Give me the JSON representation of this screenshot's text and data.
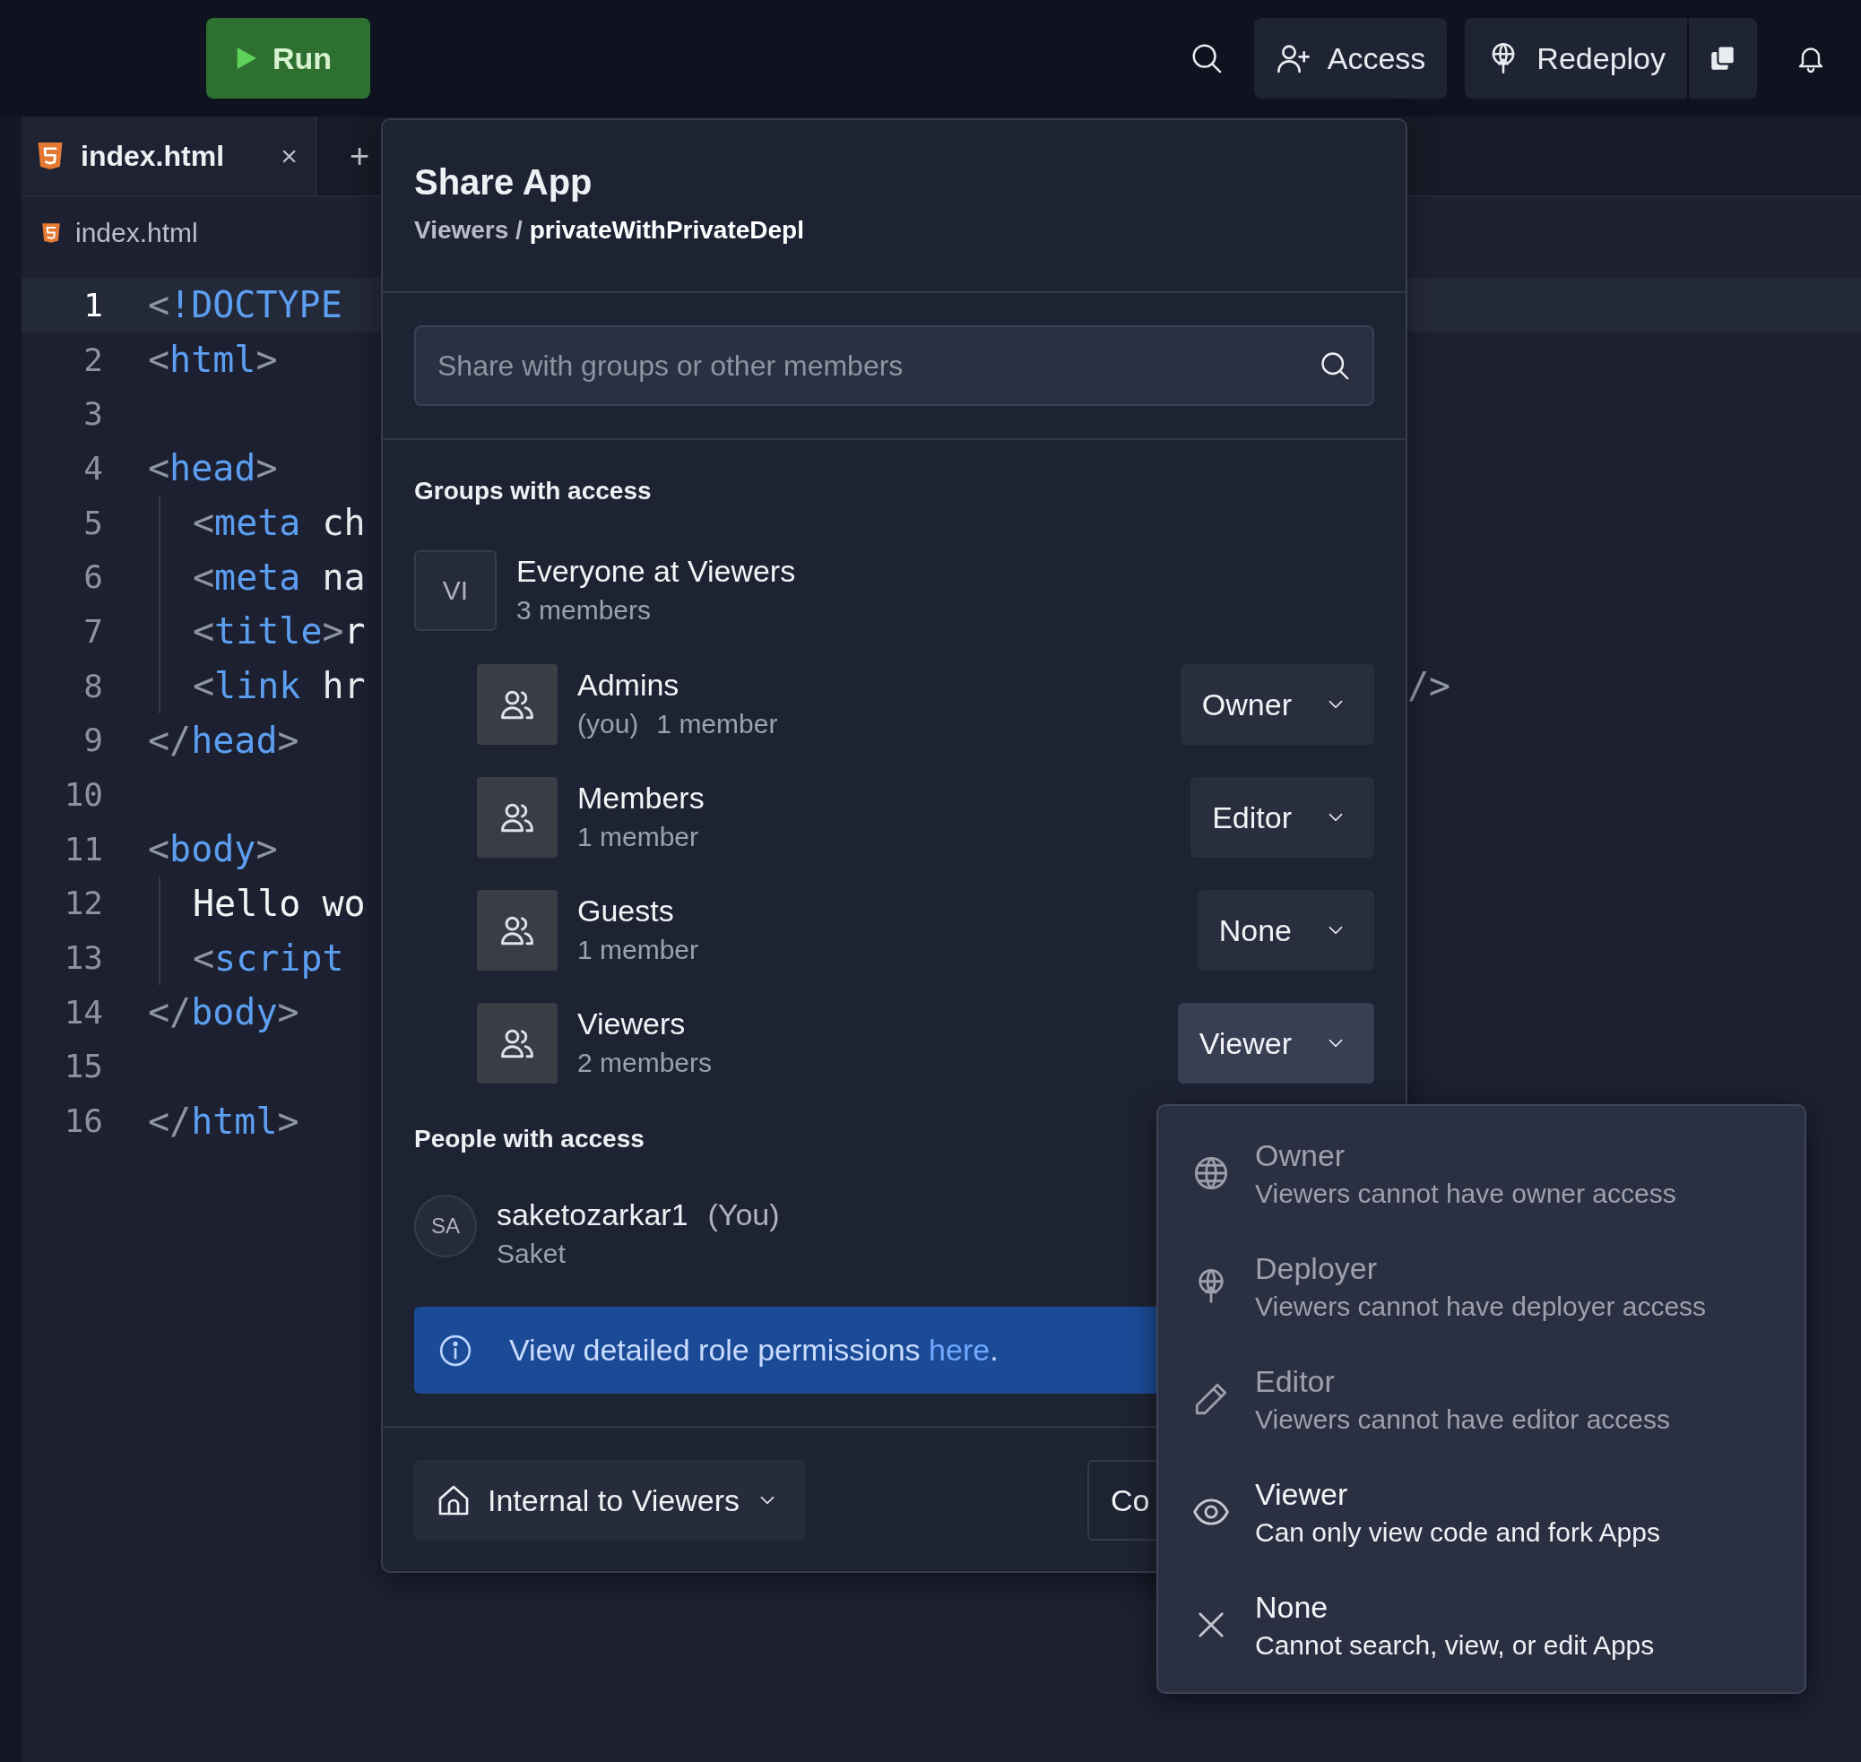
{
  "toolbar": {
    "run": "Run",
    "access": "Access",
    "redeploy": "Redeploy"
  },
  "editor": {
    "tabs": [
      {
        "label": "index.html",
        "close": "×",
        "selected": true
      }
    ],
    "new_tab": "+",
    "breadcrumb": "index.html",
    "lines": [
      {
        "number": "1",
        "current": true,
        "tokens": [
          {
            "kind": "punct",
            "text": "<"
          },
          {
            "kind": "tag",
            "text": "!DOCTYPE"
          }
        ]
      },
      {
        "number": "2",
        "current": false,
        "tokens": [
          {
            "kind": "punct",
            "text": "<"
          },
          {
            "kind": "tag",
            "text": "html"
          },
          {
            "kind": "punct",
            "text": ">"
          }
        ]
      },
      {
        "number": "3",
        "current": false
      },
      {
        "number": "4",
        "current": false,
        "tokens": [
          {
            "kind": "punct",
            "text": "<"
          },
          {
            "kind": "tag",
            "text": "head"
          },
          {
            "kind": "punct",
            "text": ">"
          }
        ],
        "children": [
          {
            "number": "5",
            "current": false,
            "tokens": [
              {
                "kind": "punct",
                "text": "<"
              },
              {
                "kind": "tag",
                "text": "meta"
              },
              {
                "kind": "attr",
                "text": " ch"
              }
            ]
          },
          {
            "number": "6",
            "current": false,
            "tokens": [
              {
                "kind": "punct",
                "text": "<"
              },
              {
                "kind": "tag",
                "text": "meta"
              },
              {
                "kind": "attr",
                "text": " na"
              }
            ]
          },
          {
            "number": "7",
            "current": false,
            "tokens": [
              {
                "kind": "punct",
                "text": "<"
              },
              {
                "kind": "tag",
                "text": "title"
              },
              {
                "kind": "punct",
                "text": ">"
              },
              {
                "kind": "text",
                "text": "r"
              }
            ]
          },
          {
            "number": "8",
            "current": false,
            "tokens": [
              {
                "kind": "punct",
                "text": "<"
              },
              {
                "kind": "tag",
                "text": "link"
              },
              {
                "kind": "attr",
                "text": " hr"
              }
            ],
            "tail": "/>"
          }
        ]
      },
      {
        "number": "9",
        "current": false,
        "tokens": [
          {
            "kind": "punct",
            "text": "</"
          },
          {
            "kind": "tag",
            "text": "head"
          },
          {
            "kind": "punct",
            "text": ">"
          }
        ]
      },
      {
        "number": "10",
        "current": false
      },
      {
        "number": "11",
        "current": false,
        "tokens": [
          {
            "kind": "punct",
            "text": "<"
          },
          {
            "kind": "tag",
            "text": "body"
          },
          {
            "kind": "punct",
            "text": ">"
          }
        ],
        "children": [
          {
            "number": "12",
            "current": false,
            "tokens": [
              {
                "kind": "text",
                "text": "Hello wo"
              }
            ]
          },
          {
            "number": "13",
            "current": false,
            "tokens": [
              {
                "kind": "punct",
                "text": "<"
              },
              {
                "kind": "tag",
                "text": "script"
              }
            ]
          }
        ]
      },
      {
        "number": "14",
        "current": false,
        "tokens": [
          {
            "kind": "punct",
            "text": "</"
          },
          {
            "kind": "tag",
            "text": "body"
          },
          {
            "kind": "punct",
            "text": ">"
          }
        ]
      },
      {
        "number": "15",
        "current": false
      },
      {
        "number": "16",
        "current": false,
        "tokens": [
          {
            "kind": "punct",
            "text": "</"
          },
          {
            "kind": "tag",
            "text": "html"
          },
          {
            "kind": "punct",
            "text": ">"
          }
        ]
      }
    ]
  },
  "share_dialog": {
    "title": "Share App",
    "org": "Viewers",
    "separator": "/",
    "app": "privateWithPrivateDepl",
    "search": {
      "placeholder": "Share with groups or other members"
    },
    "groups_heading": "Groups with access",
    "groups": [
      {
        "initials": "VI",
        "name": "Everyone at Viewers",
        "count": "3 members",
        "children": [
          {
            "name": "Admins",
            "note": "(you)",
            "count": "1 member",
            "role": "Owner",
            "open": false
          },
          {
            "name": "Members",
            "count": "1 member",
            "role": "Editor",
            "open": false
          },
          {
            "name": "Guests",
            "count": "1 member",
            "role": "None",
            "open": false
          },
          {
            "name": "Viewers",
            "count": "2 members",
            "role": "Viewer",
            "open": true
          }
        ]
      }
    ],
    "people_heading": "People with access",
    "people": [
      {
        "initials": "SA",
        "username": "saketozarkar1",
        "note": "(You)",
        "name": "Saket"
      }
    ],
    "info": {
      "text": "View detailed role permissions ",
      "link": "here",
      "end": "."
    },
    "visibility": "Internal to Viewers",
    "secondary_button": "Co"
  },
  "role_menu": {
    "items": [
      {
        "title": "Owner",
        "description": "Viewers cannot have owner access",
        "disabled": true
      },
      {
        "title": "Deployer",
        "description": "Viewers cannot have deployer access",
        "disabled": true
      },
      {
        "title": "Editor",
        "description": "Viewers cannot have editor access",
        "disabled": true
      },
      {
        "title": "Viewer",
        "description": "Can only view code and fork Apps",
        "disabled": false
      },
      {
        "title": "None",
        "description": "Cannot search, view, or edit Apps",
        "disabled": false
      }
    ]
  }
}
